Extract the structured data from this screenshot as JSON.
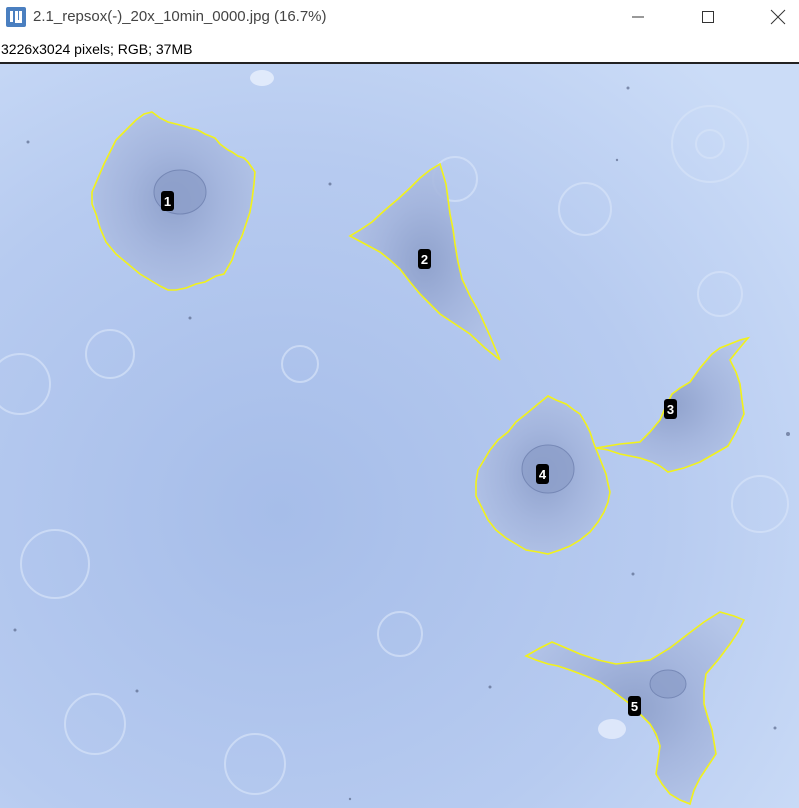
{
  "window": {
    "title": "2.1_repsox(-)_20x_10min_0000.jpg (16.7%)",
    "controls": [
      "minimize",
      "maximize",
      "close"
    ]
  },
  "info": {
    "text": "3226x3024 pixels; RGB; 37MB"
  },
  "image": {
    "background_color": "#b9cdf0",
    "roi_color": "#f2f21a",
    "cell_color": "#a9b9dc",
    "rois": [
      {
        "label": "1"
      },
      {
        "label": "2"
      },
      {
        "label": "3"
      },
      {
        "label": "4"
      },
      {
        "label": "5"
      }
    ]
  }
}
